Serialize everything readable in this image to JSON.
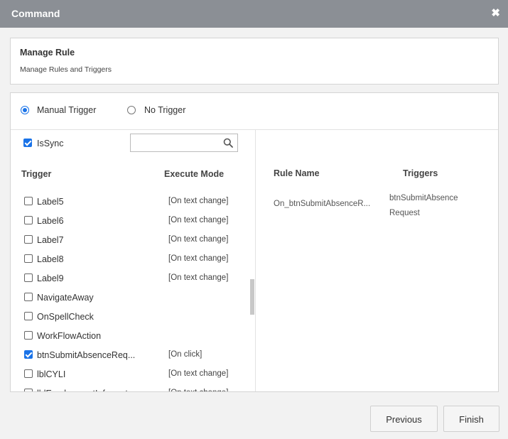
{
  "dialog": {
    "title": "Command"
  },
  "header": {
    "title": "Manage Rule",
    "subtitle": "Manage Rules and Triggers"
  },
  "trigger_type": {
    "manual_label": "Manual Trigger",
    "none_label": "No Trigger",
    "selected": "manual"
  },
  "left": {
    "issync_label": "IsSync",
    "issync_checked": true,
    "search_placeholder": "",
    "col_trigger": "Trigger",
    "col_mode": "Execute Mode",
    "rows": [
      {
        "name": "Label5",
        "mode": "[On text change]",
        "checked": false
      },
      {
        "name": "Label6",
        "mode": "[On text change]",
        "checked": false
      },
      {
        "name": "Label7",
        "mode": "[On text change]",
        "checked": false
      },
      {
        "name": "Label8",
        "mode": "[On text change]",
        "checked": false
      },
      {
        "name": "Label9",
        "mode": "[On text change]",
        "checked": false
      },
      {
        "name": "NavigateAway",
        "mode": "",
        "checked": false
      },
      {
        "name": "OnSpellCheck",
        "mode": "",
        "checked": false
      },
      {
        "name": "WorkFlowAction",
        "mode": "",
        "checked": false
      },
      {
        "name": "btnSubmitAbsenceReq...",
        "mode": "[On click]",
        "checked": true
      },
      {
        "name": "lblCYLI",
        "mode": "[On text change]",
        "checked": false
      },
      {
        "name": "lblEmploymentInformat...",
        "mode": "[On text change]",
        "checked": false
      }
    ]
  },
  "right": {
    "col_rule_name": "Rule Name",
    "col_triggers": "Triggers",
    "rules": [
      {
        "name": "On_btnSubmitAbsenceR...",
        "triggers": "btnSubmitAbsence Request"
      }
    ]
  },
  "footer": {
    "previous_label": "Previous",
    "finish_label": "Finish"
  },
  "colors": {
    "titlebar": "#8b8f95",
    "accent": "#1a73e8"
  }
}
